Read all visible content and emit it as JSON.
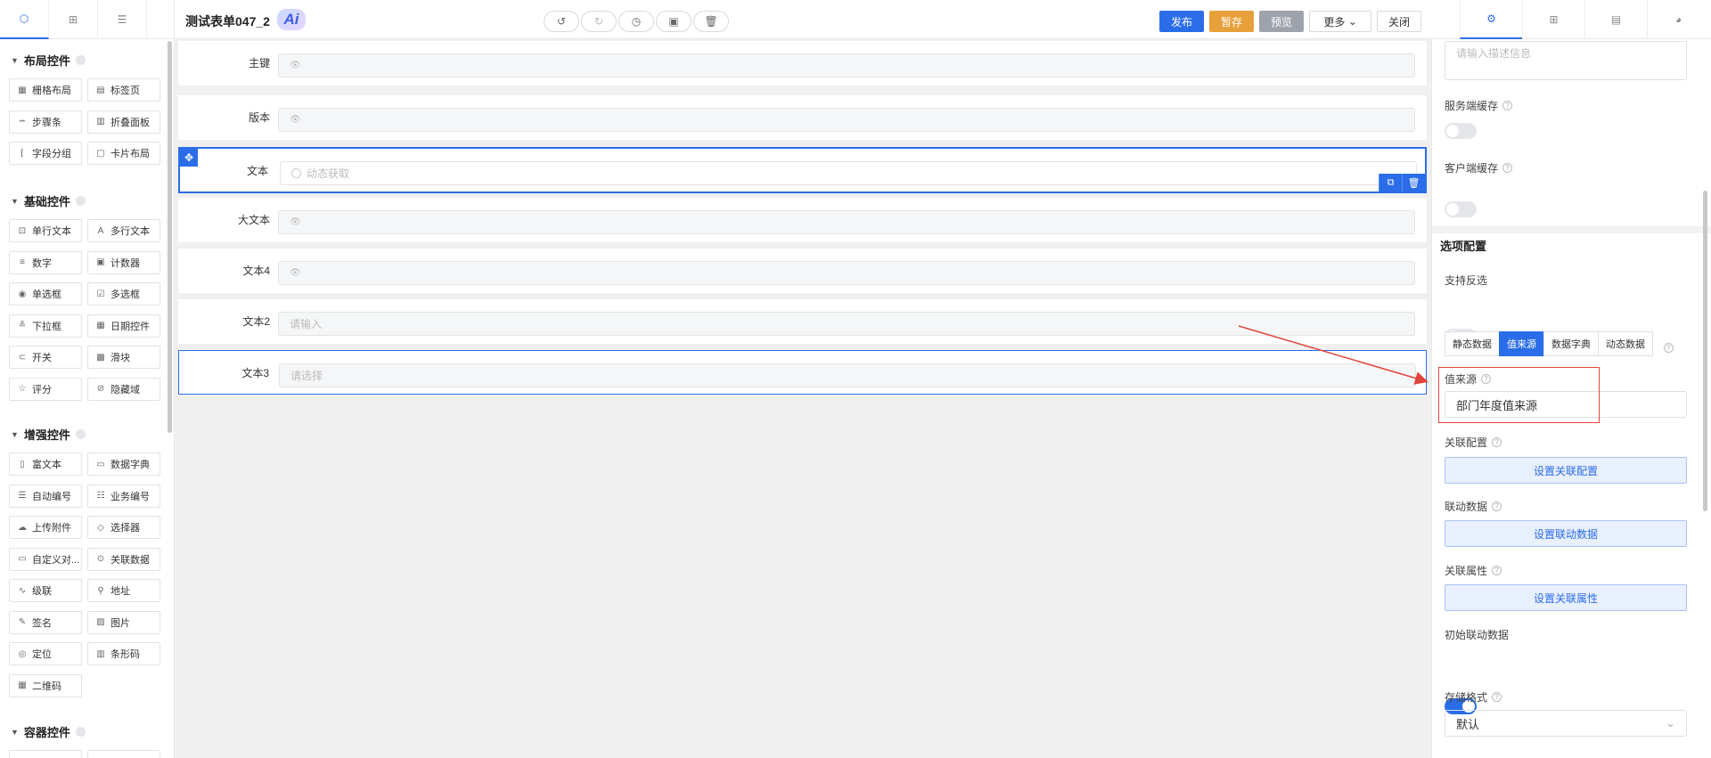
{
  "app": {
    "left_tabs": [
      "component-icon",
      "grid-icon",
      "database-icon"
    ],
    "form_title": "测试表单047_2",
    "ai_badge": "Ai",
    "toolbar_icons": [
      "undo-icon",
      "redo-icon",
      "history-icon",
      "clear-icon",
      "delete-icon"
    ],
    "actions": {
      "publish": "发布",
      "save": "暂存",
      "preview": "预览",
      "more": "更多",
      "close": "关闭"
    },
    "right_tabs": [
      "settings-icon",
      "grid-icon",
      "layout-icon",
      "palette-icon"
    ]
  },
  "palette": {
    "sections": [
      {
        "title": "布局控件",
        "items": [
          "栅格布局",
          "标签页",
          "步骤条",
          "折叠面板",
          "字段分组",
          "卡片布局"
        ]
      },
      {
        "title": "基础控件",
        "items": [
          "单行文本",
          "多行文本",
          "数字",
          "计数器",
          "单选框",
          "多选框",
          "下拉框",
          "日期控件",
          "开关",
          "滑块",
          "评分",
          "隐藏域"
        ]
      },
      {
        "title": "增强控件",
        "items": [
          "富文本",
          "数据字典",
          "自动编号",
          "业务编号",
          "上传附件",
          "选择器",
          "自定义对...",
          "关联数据",
          "级联",
          "地址",
          "签名",
          "图片",
          "定位",
          "条形码",
          "二维码"
        ]
      },
      {
        "title": "容器控件",
        "items": []
      }
    ],
    "icons": {
      "栅格布局": "▦",
      "标签页": "▤",
      "步骤条": "┅",
      "折叠面板": "▥",
      "字段分组": "⁅",
      "卡片布局": "▢",
      "单行文本": "⊡",
      "多行文本": "A",
      "数字": "≡",
      "计数器": "▣",
      "单选框": "◉",
      "多选框": "☑",
      "下拉框": "≚",
      "日期控件": "▦",
      "开关": "⊂",
      "滑块": "▩",
      "评分": "☆",
      "隐藏域": "⊘",
      "富文本": "▯",
      "数据字典": "▭",
      "自动编号": "☰",
      "业务编号": "☷",
      "上传附件": "☁",
      "选择器": "◇",
      "自定义对...": "▭",
      "关联数据": "⊙",
      "级联": "∿",
      "地址": "⚲",
      "签名": "✎",
      "图片": "▨",
      "定位": "◎",
      "条形码": "▥",
      "二维码": "▦"
    }
  },
  "canvas": {
    "fields": [
      {
        "label": "主键",
        "placeholder": "",
        "type": "readonly"
      },
      {
        "label": "版本",
        "placeholder": "",
        "type": "readonly"
      },
      {
        "label": "文本",
        "placeholder": "动态获取",
        "type": "radio"
      },
      {
        "label": "大文本",
        "placeholder": "",
        "type": "readonly"
      },
      {
        "label": "文本4",
        "placeholder": "",
        "type": "readonly"
      },
      {
        "label": "文本2",
        "placeholder": "请输入",
        "type": "input"
      },
      {
        "label": "文本3",
        "placeholder": "请选择",
        "type": "select"
      }
    ]
  },
  "props": {
    "description_placeholder": "请输入描述信息",
    "server_cache": "服务端缓存",
    "client_cache": "客户端缓存",
    "options_section": "选项配置",
    "support_reverse": "支持反选",
    "source_tabs": [
      "静态数据",
      "值来源",
      "数据字典",
      "动态数据"
    ],
    "active_source_tab": "值来源",
    "value_source_label": "值来源",
    "value_source_value": "部门年度值来源",
    "link_config_label": "关联配置",
    "link_config_button": "设置关联配置",
    "linkage_data_label": "联动数据",
    "linkage_data_button": "设置联动数据",
    "link_attr_label": "关联属性",
    "link_attr_button": "设置关联属性",
    "init_linkage_label": "初始联动数据",
    "storage_format_label": "存储格式",
    "storage_format_value": "默认"
  },
  "colors": {
    "primary": "#2b6de8",
    "save": "#e8a03a",
    "preview": "#9ea3ab",
    "annotation": "#e0453a"
  }
}
